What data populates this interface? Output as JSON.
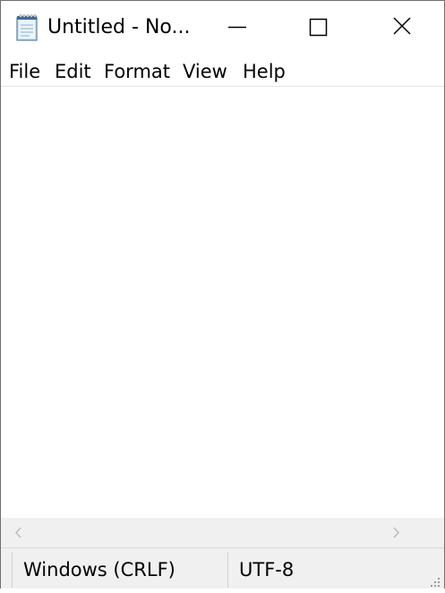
{
  "window": {
    "title": "Untitled - No...",
    "icon": "notepad-icon"
  },
  "controls": {
    "minimize_icon": "minimize-icon",
    "maximize_icon": "maximize-icon",
    "close_icon": "close-icon"
  },
  "menu": {
    "items": [
      {
        "label": "File"
      },
      {
        "label": "Edit"
      },
      {
        "label": "Format"
      },
      {
        "label": "View"
      },
      {
        "label": "Help"
      }
    ]
  },
  "editor": {
    "content": ""
  },
  "scrollbar": {
    "left_arrow": "chevron-left-icon",
    "right_arrow": "chevron-right-icon"
  },
  "status": {
    "line_ending": "Windows (CRLF)",
    "encoding": "UTF-8"
  }
}
